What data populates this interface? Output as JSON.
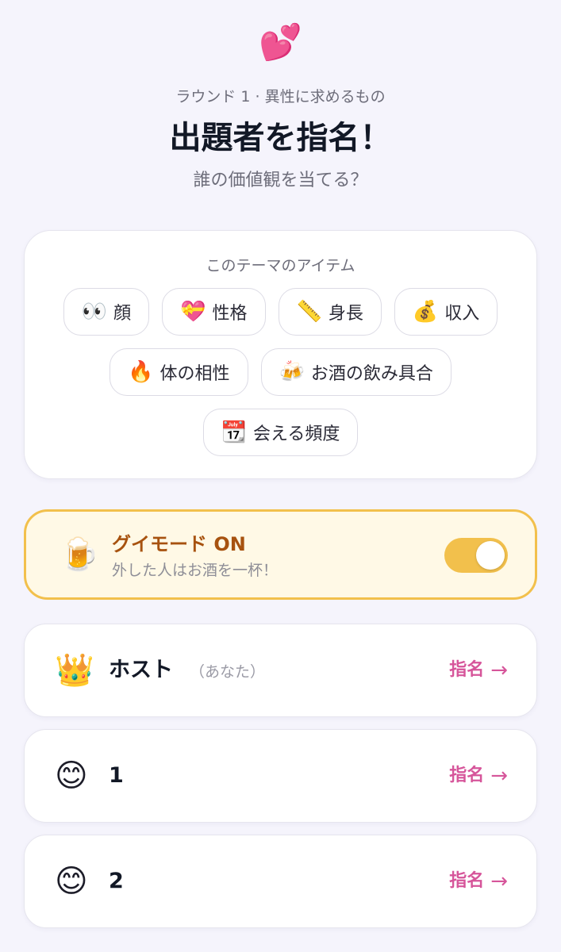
{
  "header": {
    "hero_emoji": "💕",
    "round_label": "ラウンド 1 · 異性に求めるもの",
    "title": "出題者を指名！",
    "subtitle": "誰の価値観を当てる？"
  },
  "theme": {
    "heading": "このテーマのアイテム",
    "items": [
      {
        "icon": "👀",
        "label": "顔"
      },
      {
        "icon": "💝",
        "label": "性格"
      },
      {
        "icon": "📏",
        "label": "身長"
      },
      {
        "icon": "💰",
        "label": "収入"
      },
      {
        "icon": "🔥",
        "label": "体の相性"
      },
      {
        "icon": "🍻",
        "label": "お酒の飲み具合"
      },
      {
        "icon": "📆",
        "label": "会える頻度"
      }
    ]
  },
  "drink_mode": {
    "icon": "🍺",
    "title": "グイモード ON",
    "description": "外した人はお酒を一杯！",
    "enabled": true,
    "accent_color": "#f2c04c"
  },
  "players": [
    {
      "avatar": "👑",
      "name": "ホスト",
      "tag": "（あなた）",
      "action": "指名",
      "arrow": "→"
    },
    {
      "avatar": "😊",
      "name": "1",
      "tag": "",
      "action": "指名",
      "arrow": "→"
    },
    {
      "avatar": "😊",
      "name": "2",
      "tag": "",
      "action": "指名",
      "arrow": "→"
    }
  ],
  "colors": {
    "accent_pink": "#d6559a",
    "mode_title": "#a7520f",
    "background": "#f5f4fc"
  }
}
